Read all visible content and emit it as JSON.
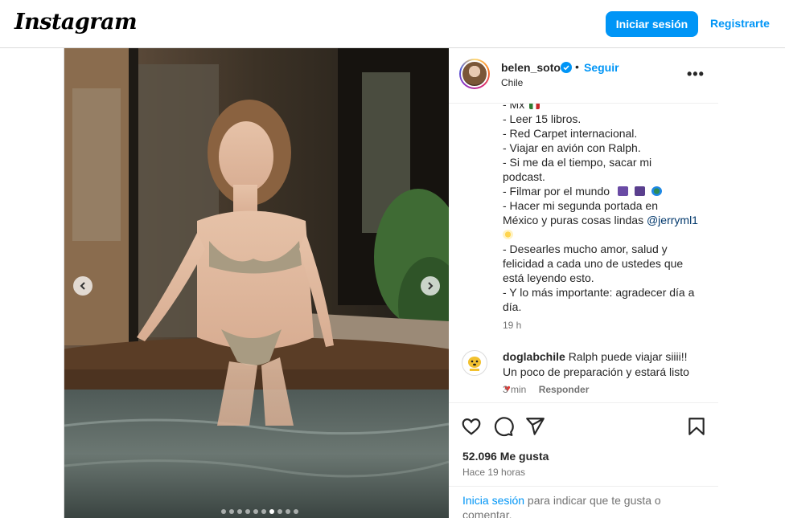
{
  "header": {
    "logo": "Instagram",
    "login_button": "Iniciar sesión",
    "register_link": "Registrarte"
  },
  "media": {
    "dots_total": 10,
    "active_dot": 7
  },
  "post": {
    "username": "belen_soto",
    "separator": "•",
    "follow_label": "Seguir",
    "location": "Chile",
    "more_label": "•••",
    "caption_lines": [
      "- Mx",
      "- Leer 15 libros.",
      "- Red Carpet internacional.",
      "- Viajar en avión con Ralph.",
      "- Si me da el tiempo, sacar mi",
      "podcast.",
      "- Filmar por el mundo",
      "- Hacer mi segunda portada en",
      "México y puras cosas lindas",
      "",
      "- Desearles mucho amor, salud y",
      "felicidad a cada uno de ustedes que",
      "está leyendo esto.",
      "- Y lo más importante: agradecer día a",
      "día."
    ],
    "mention": "@jerryml1",
    "caption_time": "19 h",
    "comment": {
      "username": "doglabchile",
      "text": "Ralph puede viajar siiii!! Un poco de preparación y estará listo",
      "time": "3 min",
      "reply_label": "Responder"
    },
    "likes": "52.096 Me gusta",
    "posted": "Hace 19 horas",
    "login_prompt": {
      "link": "Inicia sesión",
      "rest": " para indicar que te gusta o comentar."
    }
  },
  "colors": {
    "accent": "#0095f6",
    "text": "#262626",
    "muted": "#737373",
    "border": "#dbdbdb"
  },
  "icons": [
    "verified-icon",
    "more-options-icon",
    "heart-icon",
    "comment-icon",
    "share-icon",
    "bookmark-icon",
    "chevron-left-icon",
    "chevron-right-icon"
  ]
}
